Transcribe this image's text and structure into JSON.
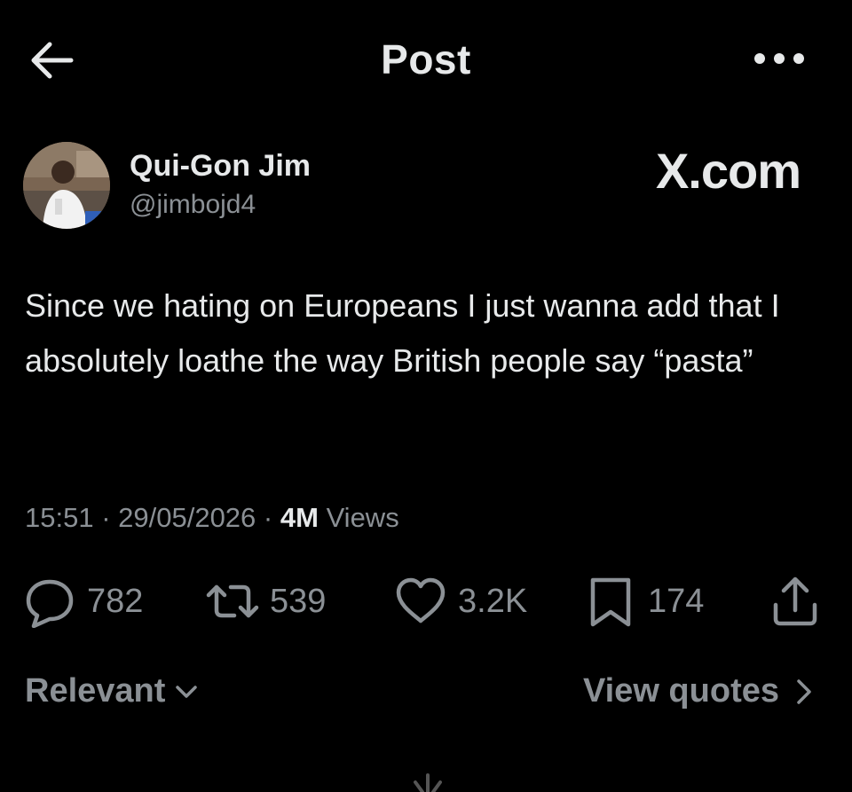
{
  "header": {
    "title": "Post",
    "back_icon": "arrow-left-icon",
    "more_icon": "more-horizontal-icon"
  },
  "author": {
    "name": "Qui-Gon Jim",
    "handle": "@jimbojd4"
  },
  "watermark": "X.com",
  "tweet": {
    "text": "Since we hating on Europeans I just wanna add that I absolutely loathe the way British people say “pasta”",
    "time": "15:51",
    "date": "29/05/2026",
    "views_count": "4M",
    "views_label": "Views"
  },
  "actions": {
    "replies": "782",
    "reposts": "539",
    "likes": "3.2K",
    "bookmarks": "174"
  },
  "footer": {
    "sort_label": "Relevant",
    "quotes_label": "View quotes"
  },
  "colors": {
    "background": "#000000",
    "primary_text": "#e7e9ea",
    "secondary_text": "#8b9095"
  }
}
